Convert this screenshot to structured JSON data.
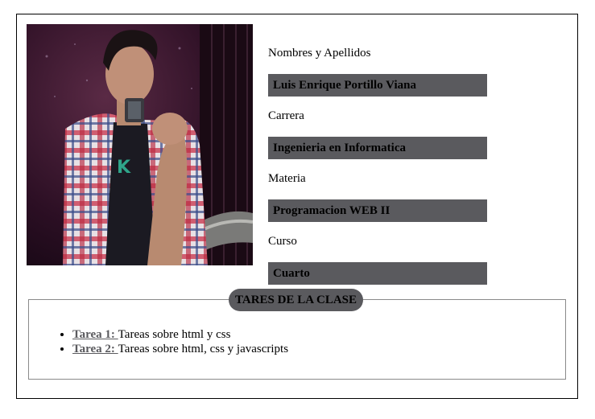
{
  "profile": {
    "photo_alt": "foto",
    "name_label": "Nombres y Apellidos",
    "name_value": "Luis Enrique Portillo Viana",
    "career_label": "Carrera",
    "career_value": "Ingenieria en Informatica",
    "subject_label": "Materia",
    "subject_value": "Programacion WEB II",
    "course_label": "Curso",
    "course_value": "Cuarto"
  },
  "tasks": {
    "title": "TARES DE LA CLASE",
    "items": [
      {
        "link": "Tarea 1: ",
        "text": "Tareas sobre html y css"
      },
      {
        "link": "Tarea 2: ",
        "text": "Tareas sobre html, css y javascripts"
      }
    ]
  },
  "colors": {
    "value_bg": "#5a5a5e",
    "border": "#000000",
    "fieldset_border": "#8a8a8a"
  }
}
